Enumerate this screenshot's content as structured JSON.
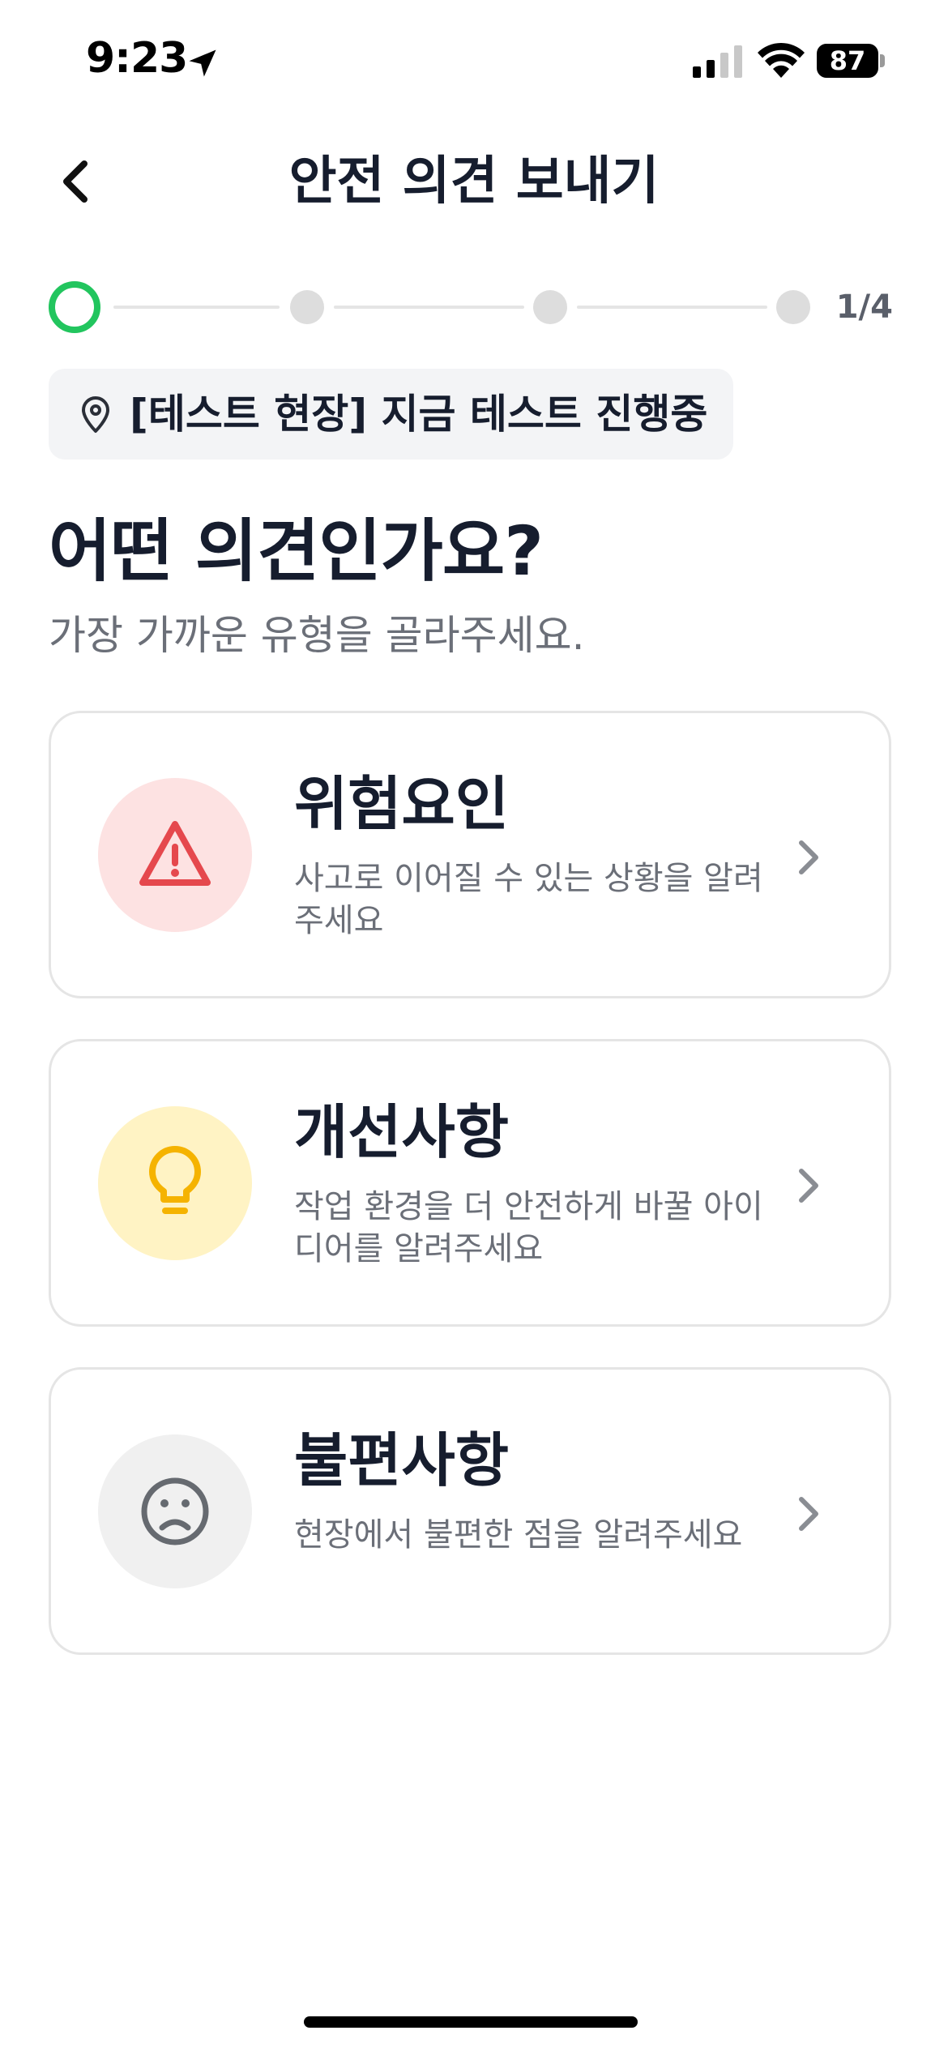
{
  "status_bar": {
    "time": "9:23",
    "battery": "87"
  },
  "header": {
    "title": "안전 의견 보내기"
  },
  "progress": {
    "current_step": 1,
    "total_steps": 4,
    "label": "1/4",
    "active_color": "#22c55e"
  },
  "location": {
    "label": "[테스트 현장] 지금 테스트 진행중"
  },
  "question": {
    "title": "어떤 의견인가요?",
    "subtitle": "가장 가까운 유형을 골라주세요."
  },
  "options": [
    {
      "title": "위험요인",
      "description": "사고로 이어질 수 있는 상황을 알려주세요",
      "icon": "warning-triangle-icon",
      "icon_color": "#e5484d",
      "bg_color": "#fde2e2"
    },
    {
      "title": "개선사항",
      "description": "작업 환경을 더 안전하게 바꿀 아이디어를 알려주세요",
      "icon": "lightbulb-icon",
      "icon_color": "#f5b300",
      "bg_color": "#fff3c4"
    },
    {
      "title": "불편사항",
      "description": "현장에서 불편한 점을 알려주세요",
      "icon": "sad-face-icon",
      "icon_color": "#666a70",
      "bg_color": "#f0f0f0"
    }
  ]
}
